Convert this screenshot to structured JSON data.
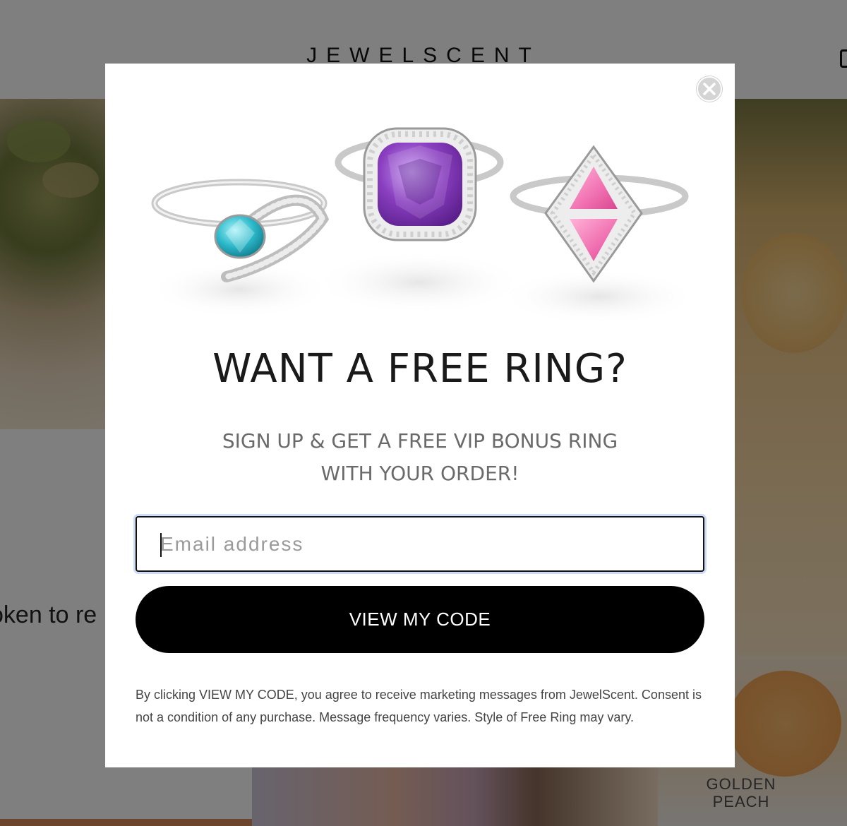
{
  "background": {
    "brand_logo": "JEWELSCENT",
    "partial_text": "oken to re",
    "product_label_line1": "GOLDEN",
    "product_label_line2": "PEACH"
  },
  "icons": {
    "close": "close-icon",
    "cart": "cart-icon"
  },
  "popup": {
    "headline": "WANT A FREE RING?",
    "subheadline_line1": "SIGN UP & GET A FREE VIP BONUS RING",
    "subheadline_line2": "WITH YOUR ORDER!",
    "email_placeholder": "Email address",
    "email_value": "",
    "cta_label": "VIEW MY CODE",
    "disclaimer": "By clicking VIEW MY CODE, you agree to receive marketing messages from JewelScent. Consent is not a condition of any purchase. Message frequency varies. Style of Free Ring may vary."
  },
  "colors": {
    "overlay": "#000000",
    "cta_background": "#000000",
    "cta_text": "#ffffff",
    "ring_left_gem": "#2bb8c9",
    "ring_center_gem": "#8a3fc0",
    "ring_right_gem": "#f06fb0"
  }
}
